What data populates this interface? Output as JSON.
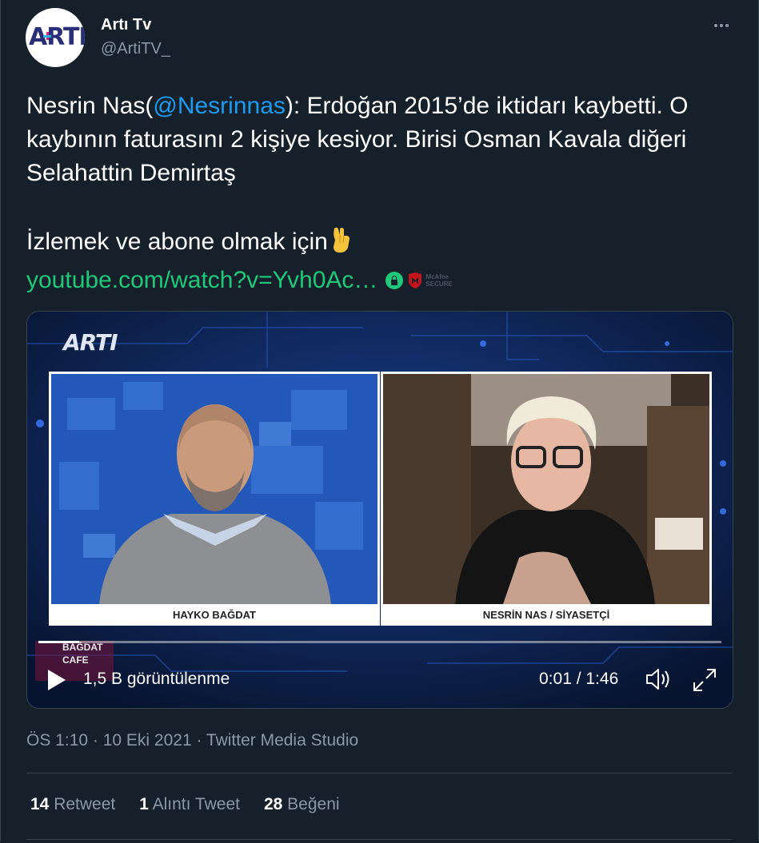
{
  "author": {
    "display_name": "Artı Tv",
    "handle": "@ArtiTV_",
    "avatar_logo": "ARTI",
    "more_icon": "more-horizontal-icon"
  },
  "tweet": {
    "text_before_mention": "Nesrin Nas(",
    "mention": "@Nesrinnas",
    "text_after_mention": "): Erdoğan 2015’de iktidarı kaybetti. O kaybının faturasını 2 kişiye kesiyor. Birisi Osman Kavala diğeri Selahattin Demirtaş",
    "line2": "İzlemek ve abone olmak için",
    "line2_emoji": "pointing-down-emoji",
    "link": "youtube.com/watch?v=Yvh0Ac…",
    "mcafee_line1": "McAfee",
    "mcafee_line2": "SECURE"
  },
  "video": {
    "channel_logo": "ARTI",
    "left_caption": "HAYKO BAĞDAT",
    "right_caption": "NESRİN NAS / SİYASETÇİ",
    "show_badge_line1": "BAĞDAT",
    "show_badge_line2": "CAFE",
    "views": "1,5 B görüntülenme",
    "time": "0:01 / 1:46",
    "progress": 0.01
  },
  "meta": {
    "timestamp": "ÖS 1:10 · 10 Eki 2021 · Twitter Media Studio"
  },
  "stats": {
    "retweets_count": "14",
    "retweets_label": "Retweet",
    "quotes_count": "1",
    "quotes_label": "Alıntı Tweet",
    "likes_count": "28",
    "likes_label": "Beğeni"
  },
  "colors": {
    "background": "#15202b",
    "link_green": "#1ec97b",
    "mention_blue": "#1d9bf0",
    "muted": "#8b98a5"
  }
}
